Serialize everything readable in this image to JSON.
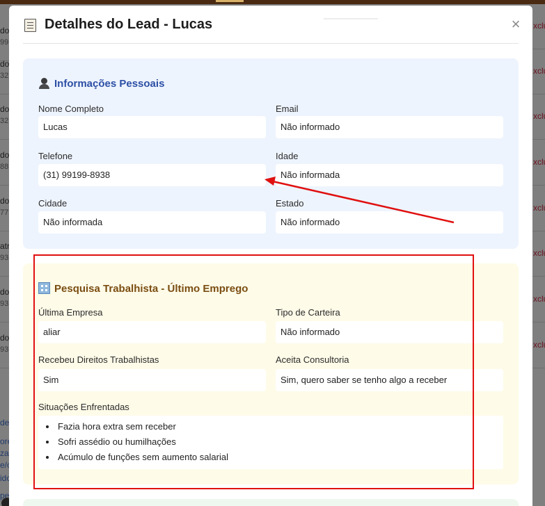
{
  "background": {
    "left_rows": [
      {
        "a": "do",
        "b": "99"
      },
      {
        "a": "do",
        "b": "32"
      },
      {
        "a": "do",
        "b": "32"
      },
      {
        "a": "do",
        "b": "88"
      },
      {
        "a": "do",
        "b": "77"
      },
      {
        "a": "atr",
        "b": "93"
      },
      {
        "a": "do",
        "b": "93"
      },
      {
        "a": "do",
        "b": "93"
      }
    ],
    "right_rows": [
      "xclu",
      "xclu",
      "xclu",
      "xclu",
      "xclu",
      "xclu",
      "xclu",
      "xclu"
    ],
    "bottom_left_lines": [
      "de",
      "ore",
      "zac",
      "e/c",
      "ido",
      "pe"
    ]
  },
  "modal": {
    "title": "Detalhes do Lead - Lucas",
    "title_icon": "document-icon",
    "close_label": "×"
  },
  "personal": {
    "title": "Informações Pessoais",
    "icon": "person-silhouette-icon",
    "fields": [
      {
        "label": "Nome Completo",
        "value": "Lucas"
      },
      {
        "label": "Email",
        "value": "Não informado"
      },
      {
        "label": "Telefone",
        "value": "(31) 99199-8938"
      },
      {
        "label": "Idade",
        "value": "Não informada"
      },
      {
        "label": "Cidade",
        "value": "Não informada"
      },
      {
        "label": "Estado",
        "value": "Não informado"
      }
    ]
  },
  "work": {
    "title": "Pesquisa Trabalhista - Último Emprego",
    "icon": "office-building-icon",
    "fields": [
      {
        "label": "Última Empresa",
        "value": "aliar"
      },
      {
        "label": "Tipo de Carteira",
        "value": "Não informado"
      },
      {
        "label": "Recebeu Direitos Trabalhistas",
        "value": "Sim"
      },
      {
        "label": "Aceita Consultoria",
        "value": "Sim, quero saber se tenho algo a receber"
      }
    ],
    "situations_label": "Situações Enfrentadas",
    "situations": [
      "Fazia hora extra sem receber",
      "Sofri assédio ou humilhações",
      "Acúmulo de funções sem aumento salarial"
    ]
  },
  "colors": {
    "overlay": "#7d7d7d",
    "personal_bg": "#eef4fe",
    "personal_title": "#2c4fa5",
    "work_bg": "#fefbe8",
    "work_title": "#7a4d12",
    "annotation": "#e01010",
    "exclude_link": "#6b1320"
  }
}
